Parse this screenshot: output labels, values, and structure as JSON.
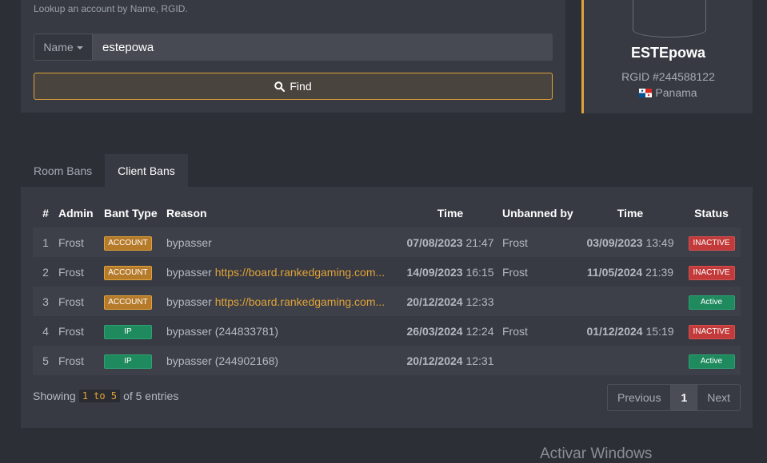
{
  "search": {
    "hint": "Lookup an account by Name, RGID.",
    "field_label": "Name",
    "query": "estepowa",
    "find_label": "Find"
  },
  "profile": {
    "name": "ESTEpowa",
    "rgid": "RGID #244588122",
    "country": "Panama",
    "accent_color": "#e0a23a"
  },
  "tabs": [
    {
      "label": "Room Bans",
      "active": false
    },
    {
      "label": "Client Bans",
      "active": true
    }
  ],
  "table": {
    "headers": [
      "#",
      "Admin",
      "Bant Type",
      "Reason",
      "Time",
      "Unbanned by",
      "Time",
      "Status"
    ],
    "rows": [
      {
        "num": "1",
        "admin": "Frost",
        "type": "ACCOUNT",
        "reason": "bypasser",
        "link": "",
        "date": "07/08/2023",
        "clock": "21:47",
        "unbanned_by": "Frost",
        "udate": "03/09/2023",
        "uclock": "13:49",
        "status": "INACTIVE"
      },
      {
        "num": "2",
        "admin": "Frost",
        "type": "ACCOUNT",
        "reason": "bypasser",
        "link": "https://board.rankedgaming.com...",
        "date": "14/09/2023",
        "clock": "16:15",
        "unbanned_by": "Frost",
        "udate": "11/05/2024",
        "uclock": "21:39",
        "status": "INACTIVE"
      },
      {
        "num": "3",
        "admin": "Frost",
        "type": "ACCOUNT",
        "reason": "bypasser",
        "link": "https://board.rankedgaming.com...",
        "date": "20/12/2024",
        "clock": "12:33",
        "unbanned_by": "",
        "udate": "",
        "uclock": "",
        "status": "Active"
      },
      {
        "num": "4",
        "admin": "Frost",
        "type": "IP",
        "reason": "bypasser (244833781)",
        "link": "",
        "date": "26/03/2024",
        "clock": "12:24",
        "unbanned_by": "Frost",
        "udate": "01/12/2024",
        "uclock": "15:19",
        "status": "INACTIVE"
      },
      {
        "num": "5",
        "admin": "Frost",
        "type": "IP",
        "reason": "bypasser (244902168)",
        "link": "",
        "date": "20/12/2024",
        "clock": "12:31",
        "unbanned_by": "",
        "udate": "",
        "uclock": "",
        "status": "Active"
      }
    ]
  },
  "footer": {
    "showing_prefix": "Showing",
    "range": "1 to 5",
    "showing_suffix": "of 5 entries",
    "prev_label": "Previous",
    "page": "1",
    "next_label": "Next"
  },
  "watermark": "Activar Windows"
}
